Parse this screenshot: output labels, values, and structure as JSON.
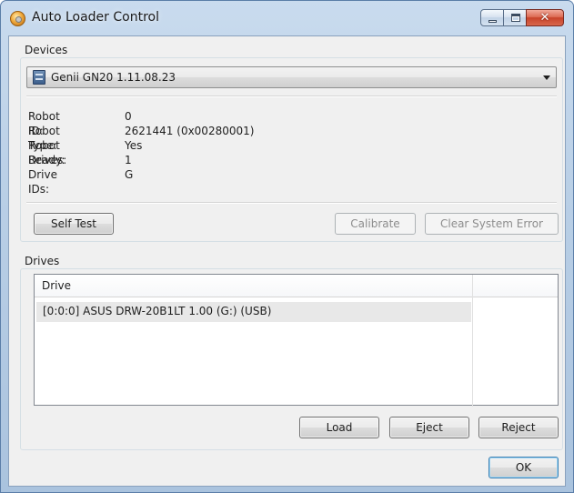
{
  "window": {
    "title": "Auto Loader Control",
    "close_glyph": "✕"
  },
  "devices": {
    "group_label": "Devices",
    "selected_device": "Genii GN20 1.11.08.23",
    "info": [
      {
        "key": "Robot ID:",
        "value": "0"
      },
      {
        "key": "Robot Type:",
        "value": "2621441 (0x00280001)"
      },
      {
        "key": "Robot Ready:",
        "value": "Yes"
      },
      {
        "key": "Drives:",
        "value": "1"
      },
      {
        "key": "Drive IDs:",
        "value": "G"
      }
    ],
    "buttons": {
      "self_test": "Self Test",
      "calibrate": "Calibrate",
      "clear_system_error": "Clear System Error"
    }
  },
  "drives": {
    "group_label": "Drives",
    "column_header": "Drive",
    "rows": [
      "[0:0:0] ASUS DRW-20B1LT 1.00 (G:) (USB)"
    ],
    "buttons": {
      "load": "Load",
      "eject": "Eject",
      "reject": "Reject"
    }
  },
  "footer": {
    "ok": "OK"
  },
  "colors": {
    "title_bar": "#b9cfe6",
    "client_bg": "#f0f0f0",
    "close_button": "#c8432a",
    "selected_row": "#e8e8e8"
  }
}
